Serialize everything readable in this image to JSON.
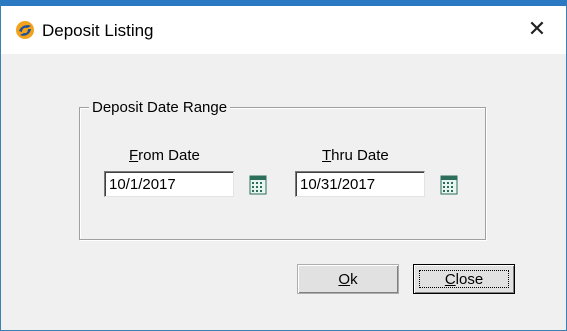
{
  "window": {
    "title": "Deposit Listing",
    "close_glyph": "✕",
    "icon": "app-logo-icon",
    "accent_color": "#2b79c2"
  },
  "group": {
    "label": "Deposit Date Range"
  },
  "from": {
    "label_first": "F",
    "label_rest": "rom Date",
    "value": "10/1/2017",
    "calendar_icon": "calendar-icon"
  },
  "thru": {
    "label_first": "T",
    "label_rest": "hru Date",
    "value": "10/31/2017",
    "calendar_icon": "calendar-icon"
  },
  "buttons": {
    "ok_first": "O",
    "ok_rest": "k",
    "close_first": "C",
    "close_rest": "lose"
  }
}
